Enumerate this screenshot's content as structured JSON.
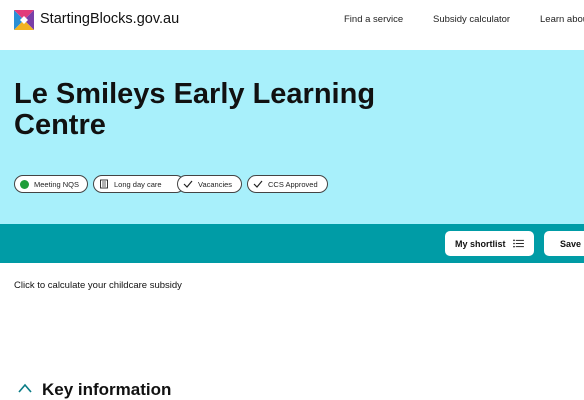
{
  "header": {
    "brand": "StartingBlocks.gov.au",
    "nav": [
      "Find a service",
      "Subsidy calculator",
      "Learn abou"
    ]
  },
  "hero": {
    "title": "Le Smileys Early Learning Centre",
    "tags": [
      "Meeting NQS",
      "Long day care",
      "Vacancies",
      "CCS Approved"
    ]
  },
  "actions": {
    "shortlist_label": "My shortlist",
    "save_label": "Save"
  },
  "subsidy": {
    "text": "Click to calculate your childcare subsidy"
  },
  "section": {
    "heading": "Key information"
  },
  "colors": {
    "hero_bg": "#a8f0fb",
    "teal_bar": "#009ca6",
    "nqs_dot": "#1f9d3a"
  },
  "icons": [
    "logo-icon",
    "nqs-status-dot-icon",
    "building-icon",
    "checkmark-icon",
    "list-icon",
    "home-icon"
  ]
}
